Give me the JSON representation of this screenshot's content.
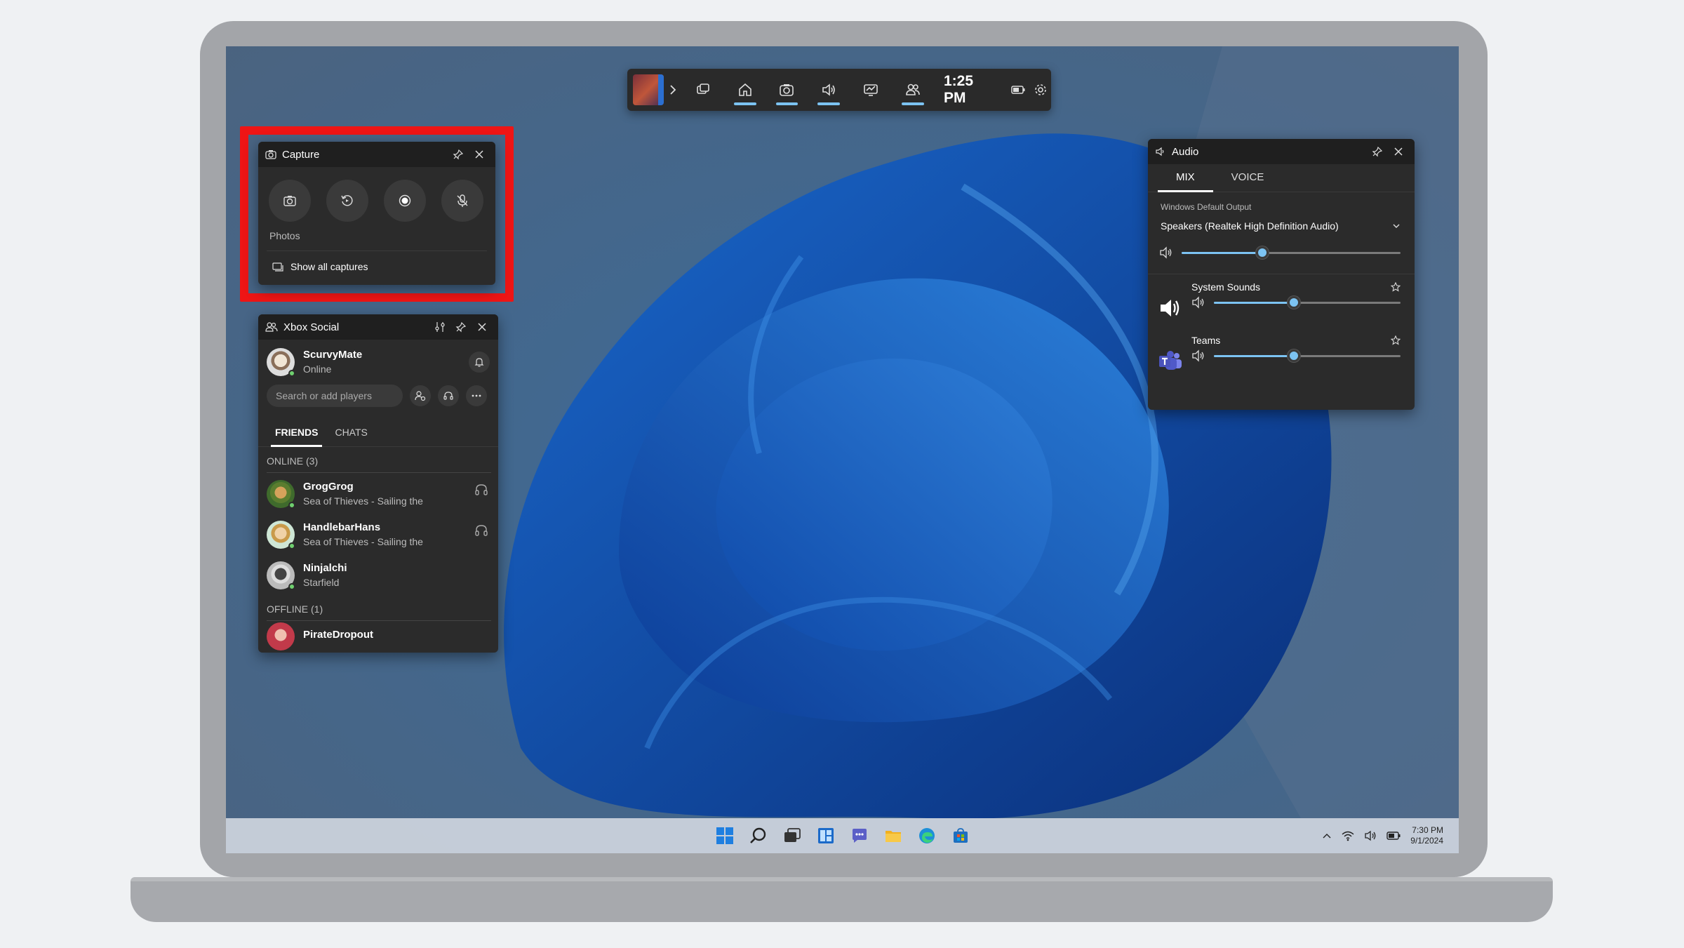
{
  "gamebar": {
    "time": "1:25 PM",
    "widgets": [
      "widget-menu",
      "home",
      "capture",
      "audio",
      "performance",
      "xbox-social"
    ]
  },
  "capture": {
    "title": "Capture",
    "gallery_label": "Photos",
    "show_all_label": "Show all captures",
    "buttons": [
      "screenshot",
      "record-last-30-seconds",
      "start-recording",
      "microphone-off"
    ]
  },
  "social": {
    "title": "Xbox Social",
    "user": {
      "name": "ScurvyMate",
      "status": "Online"
    },
    "search_placeholder": "Search or add players",
    "tabs": [
      "FRIENDS",
      "CHATS"
    ],
    "online_header": "ONLINE (3)",
    "offline_header": "OFFLINE (1)",
    "friends": [
      {
        "name": "GrogGrog",
        "activity": "Sea of Thieves - Sailing the",
        "party": true
      },
      {
        "name": "HandlebarHans",
        "activity": "Sea of Thieves - Sailing the",
        "party": true
      },
      {
        "name": "Ninjalchi",
        "activity": "Starfield",
        "party": false
      }
    ],
    "offline": [
      {
        "name": "PirateDropout"
      }
    ]
  },
  "audio": {
    "title": "Audio",
    "tabs": [
      "MIX",
      "VOICE"
    ],
    "output_label": "Windows Default Output",
    "device": "Speakers (Realtek High Definition Audio)",
    "master_volume": 0.37,
    "apps": [
      {
        "name": "System Sounds",
        "volume": 0.43
      },
      {
        "name": "Teams",
        "volume": 0.43
      }
    ]
  },
  "taskbar": {
    "time": "7:30 PM",
    "date": "9/1/2024"
  },
  "colors": {
    "highlight": "#ee1515",
    "accent": "#7cc3f2",
    "panel": "#2b2b2b"
  }
}
